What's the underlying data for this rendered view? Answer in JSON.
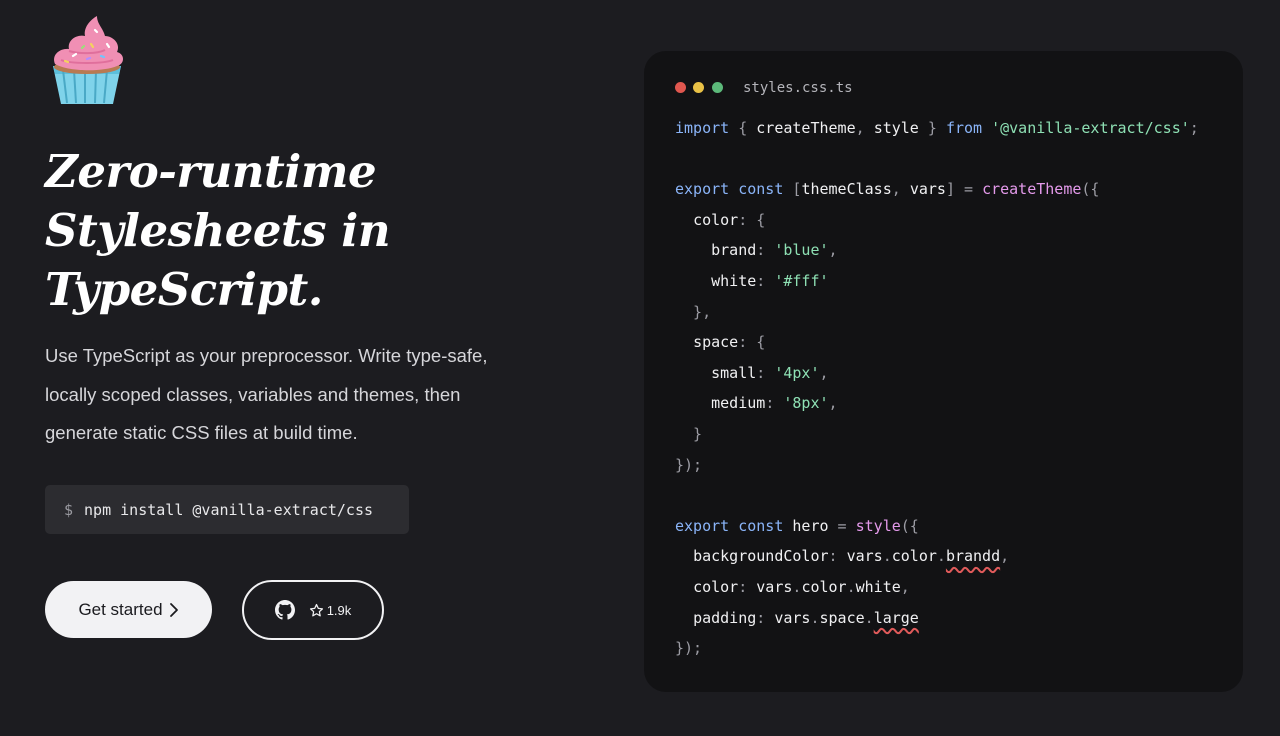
{
  "hero": {
    "logo_icon": "cupcake-icon",
    "headline_lines": [
      "Zero-runtime",
      "Stylesheets in",
      "TypeScript."
    ],
    "tagline_lines": [
      "Use TypeScript as your preprocessor. Write type-safe,",
      "locally scoped classes, variables and themes, then",
      "generate static CSS files at build time."
    ],
    "install": {
      "prompt": "$",
      "command": "npm install @vanilla-extract/css"
    },
    "get_started_label": "Get started",
    "github_stars": "1.9k"
  },
  "code_window": {
    "filename": "styles.css.ts",
    "traffic_lights": [
      "#e0574f",
      "#e9c146",
      "#5cb97a"
    ],
    "lines": [
      [
        [
          "import",
          "kw"
        ],
        [
          " { ",
          "pun"
        ],
        [
          "createTheme",
          "id"
        ],
        [
          ", ",
          "pun"
        ],
        [
          "style",
          "id"
        ],
        [
          " } ",
          "pun"
        ],
        [
          "from",
          "kw"
        ],
        [
          " ",
          "pun"
        ],
        [
          "'@vanilla-extract/css'",
          "str"
        ],
        [
          ";",
          "pun"
        ]
      ],
      [],
      [
        [
          "export",
          "kw"
        ],
        [
          " ",
          "pun"
        ],
        [
          "const",
          "kw"
        ],
        [
          " [",
          "pun"
        ],
        [
          "themeClass",
          "id"
        ],
        [
          ", ",
          "pun"
        ],
        [
          "vars",
          "id"
        ],
        [
          "] = ",
          "pun"
        ],
        [
          "createTheme",
          "fn"
        ],
        [
          "({",
          "pun"
        ]
      ],
      [
        [
          "  ",
          "pun"
        ],
        [
          "color",
          "id"
        ],
        [
          ": {",
          "pun"
        ]
      ],
      [
        [
          "    ",
          "pun"
        ],
        [
          "brand",
          "id"
        ],
        [
          ": ",
          "pun"
        ],
        [
          "'blue'",
          "str"
        ],
        [
          ",",
          "pun"
        ]
      ],
      [
        [
          "    ",
          "pun"
        ],
        [
          "white",
          "id"
        ],
        [
          ": ",
          "pun"
        ],
        [
          "'#fff'",
          "str"
        ]
      ],
      [
        [
          "  },",
          "pun"
        ]
      ],
      [
        [
          "  ",
          "pun"
        ],
        [
          "space",
          "id"
        ],
        [
          ": {",
          "pun"
        ]
      ],
      [
        [
          "    ",
          "pun"
        ],
        [
          "small",
          "id"
        ],
        [
          ": ",
          "pun"
        ],
        [
          "'4px'",
          "str"
        ],
        [
          ",",
          "pun"
        ]
      ],
      [
        [
          "    ",
          "pun"
        ],
        [
          "medium",
          "id"
        ],
        [
          ": ",
          "pun"
        ],
        [
          "'8px'",
          "str"
        ],
        [
          ",",
          "pun"
        ]
      ],
      [
        [
          "  }",
          "pun"
        ]
      ],
      [
        [
          "});",
          "pun"
        ]
      ],
      [],
      [
        [
          "export",
          "kw"
        ],
        [
          " ",
          "pun"
        ],
        [
          "const",
          "kw"
        ],
        [
          " ",
          "pun"
        ],
        [
          "hero",
          "id"
        ],
        [
          " = ",
          "pun"
        ],
        [
          "style",
          "fn"
        ],
        [
          "({",
          "pun"
        ]
      ],
      [
        [
          "  ",
          "pun"
        ],
        [
          "backgroundColor",
          "id"
        ],
        [
          ": ",
          "pun"
        ],
        [
          "vars",
          "id"
        ],
        [
          ".",
          "pun"
        ],
        [
          "color",
          "id"
        ],
        [
          ".",
          "pun"
        ],
        [
          "brandd",
          "err"
        ],
        [
          ",",
          "pun"
        ]
      ],
      [
        [
          "  ",
          "pun"
        ],
        [
          "color",
          "id"
        ],
        [
          ": ",
          "pun"
        ],
        [
          "vars",
          "id"
        ],
        [
          ".",
          "pun"
        ],
        [
          "color",
          "id"
        ],
        [
          ".",
          "pun"
        ],
        [
          "white",
          "id"
        ],
        [
          ",",
          "pun"
        ]
      ],
      [
        [
          "  ",
          "pun"
        ],
        [
          "padding",
          "id"
        ],
        [
          ": ",
          "pun"
        ],
        [
          "vars",
          "id"
        ],
        [
          ".",
          "pun"
        ],
        [
          "space",
          "id"
        ],
        [
          ".",
          "pun"
        ],
        [
          "large",
          "err"
        ]
      ],
      [
        [
          "});",
          "pun"
        ]
      ]
    ]
  }
}
